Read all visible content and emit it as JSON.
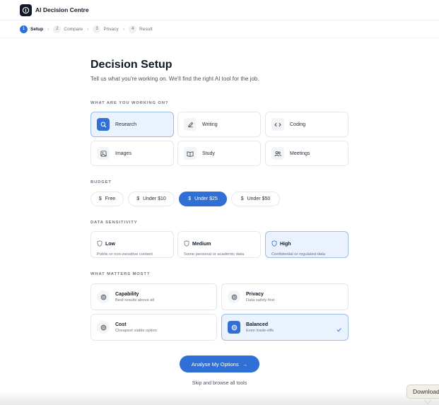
{
  "app": {
    "title": "AI Decision Centre"
  },
  "steps": [
    {
      "num": "1",
      "label": "Setup"
    },
    {
      "num": "2",
      "label": "Compare"
    },
    {
      "num": "3",
      "label": "Privacy"
    },
    {
      "num": "4",
      "label": "Result"
    }
  ],
  "page": {
    "title": "Decision Setup",
    "subtitle": "Tell us what you're working on. We'll find the right AI tool for the job."
  },
  "task": {
    "label": "WHAT ARE YOU WORKING ON?",
    "options": [
      {
        "label": "Research",
        "icon": "search-icon",
        "selected": true
      },
      {
        "label": "Writing",
        "icon": "pencil-icon",
        "selected": false
      },
      {
        "label": "Coding",
        "icon": "code-icon",
        "selected": false
      },
      {
        "label": "Images",
        "icon": "image-icon",
        "selected": false
      },
      {
        "label": "Study",
        "icon": "book-icon",
        "selected": false
      },
      {
        "label": "Meetings",
        "icon": "users-icon",
        "selected": false
      }
    ]
  },
  "budget": {
    "label": "BUDGET",
    "currency": "$",
    "options": [
      {
        "label": "Free",
        "selected": false
      },
      {
        "label": "Under $10",
        "selected": false
      },
      {
        "label": "Under $25",
        "selected": true
      },
      {
        "label": "Under $50",
        "selected": false
      }
    ]
  },
  "sensitivity": {
    "label": "DATA SENSITIVITY",
    "options": [
      {
        "title": "Low",
        "desc": "Public or non-sensitive content",
        "icon": "shield-icon",
        "selected": false
      },
      {
        "title": "Medium",
        "desc": "Some personal or academic data",
        "icon": "shield-icon",
        "selected": false
      },
      {
        "title": "High",
        "desc": "Confidential or regulated data",
        "icon": "shield-icon",
        "selected": true
      }
    ]
  },
  "priority": {
    "label": "WHAT MATTERS MOST?",
    "options": [
      {
        "title": "Capability",
        "desc": "Best results above all",
        "icon": "target-icon",
        "selected": false
      },
      {
        "title": "Privacy",
        "desc": "Data safety first",
        "icon": "target-icon",
        "selected": false
      },
      {
        "title": "Cost",
        "desc": "Cheapest viable option",
        "icon": "target-icon",
        "selected": false
      },
      {
        "title": "Balanced",
        "desc": "Even trade-offs",
        "icon": "target-icon",
        "selected": true
      }
    ]
  },
  "actions": {
    "primary": "Analyse My Options",
    "primary_arrow": "→",
    "secondary": "Skip and browse all tools"
  },
  "download": {
    "label": "Download"
  },
  "colors": {
    "accent": "#2f6fd6",
    "selected_bg": "#eaf2fd"
  }
}
